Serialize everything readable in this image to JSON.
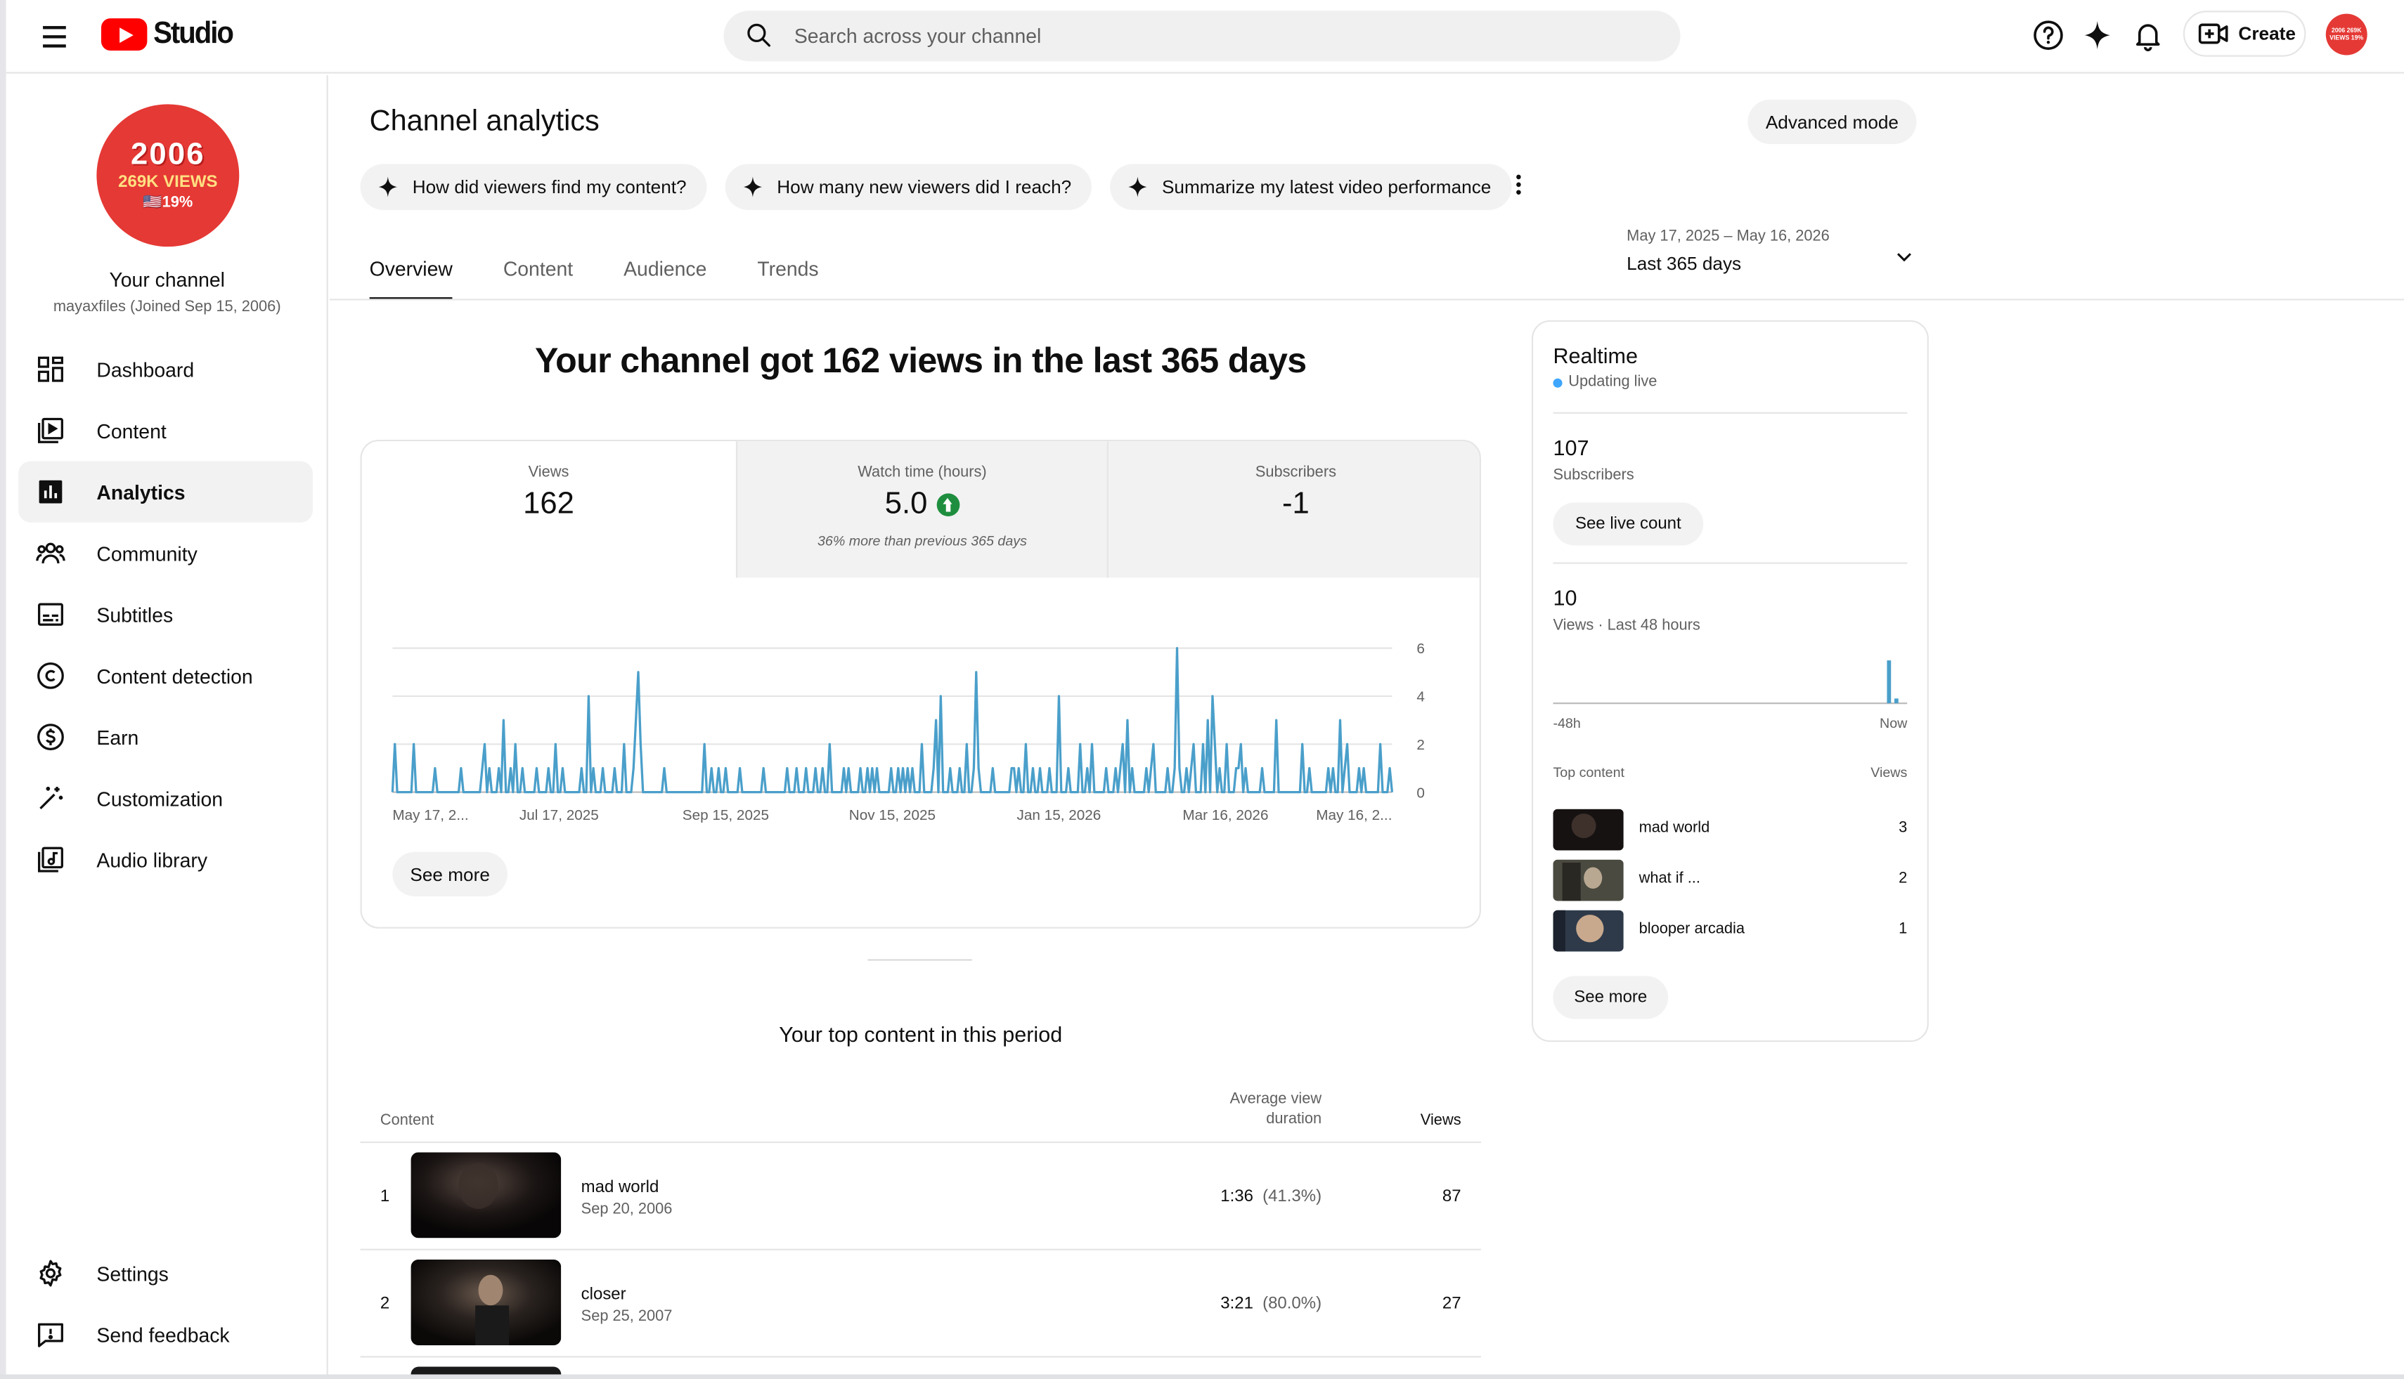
{
  "app": {
    "logo_text": "Studio",
    "brand_color": "#ff0000",
    "accent_color": "#3ea6ff",
    "positive_color": "#1e8e3e"
  },
  "header": {
    "search_placeholder": "Search across your channel",
    "create_label": "Create",
    "avatar_text": "2006 269K VIEWS 19%",
    "icons": [
      "menu-icon",
      "search-icon",
      "help-icon",
      "sparkle-icon",
      "bell-icon",
      "create-video-icon"
    ]
  },
  "sidebar": {
    "avatar": {
      "line1": "2006",
      "line2": "269K VIEWS",
      "line3": "🇺🇸19%"
    },
    "channel_name": "Your channel",
    "channel_handle": "mayaxfiles (Joined Sep 15, 2006)",
    "items": [
      {
        "label": "Dashboard",
        "icon": "dashboard-icon"
      },
      {
        "label": "Content",
        "icon": "content-icon"
      },
      {
        "label": "Analytics",
        "icon": "analytics-icon",
        "active": true
      },
      {
        "label": "Community",
        "icon": "community-icon"
      },
      {
        "label": "Subtitles",
        "icon": "subtitles-icon"
      },
      {
        "label": "Content detection",
        "icon": "copyright-icon"
      },
      {
        "label": "Earn",
        "icon": "earn-icon"
      },
      {
        "label": "Customization",
        "icon": "magic-wand-icon"
      },
      {
        "label": "Audio library",
        "icon": "audio-library-icon"
      }
    ],
    "bottom_items": [
      {
        "label": "Settings",
        "icon": "gear-icon"
      },
      {
        "label": "Send feedback",
        "icon": "feedback-icon"
      }
    ]
  },
  "main": {
    "title": "Channel analytics",
    "advanced_mode_label": "Advanced mode",
    "chips": [
      "How did viewers find my content?",
      "How many new viewers did I reach?",
      "Summarize my latest video performance"
    ],
    "tabs": [
      "Overview",
      "Content",
      "Audience",
      "Trends"
    ],
    "active_tab": "Overview",
    "date_range": {
      "range": "May 17, 2025 – May 16, 2026",
      "label": "Last 365 days"
    }
  },
  "overview": {
    "headline": "Your channel got 162 views in the last 365 days",
    "metrics": [
      {
        "label": "Views",
        "value": "162",
        "sub": ""
      },
      {
        "label": "Watch time (hours)",
        "value": "5.0",
        "sub": "36% more than previous 365 days",
        "trend": "up"
      },
      {
        "label": "Subscribers",
        "value": "-1",
        "sub": ""
      }
    ],
    "see_more_label": "See more"
  },
  "chart_data": {
    "type": "line",
    "title": "",
    "xlabel": "",
    "ylabel": "",
    "series": [
      {
        "name": "Views",
        "values": [
          0,
          2,
          0,
          0,
          0,
          0,
          0,
          0,
          0,
          2,
          0,
          0,
          0,
          0,
          0,
          0,
          0,
          0,
          1,
          0,
          0,
          0,
          0,
          0,
          0,
          0,
          0,
          0,
          0,
          1,
          0,
          0,
          0,
          0,
          0,
          0,
          0,
          0,
          1,
          2,
          0,
          1,
          0,
          0,
          0,
          1,
          0,
          3,
          0,
          0,
          1,
          0,
          2,
          0,
          0,
          1,
          0,
          0,
          0,
          0,
          0,
          1,
          0,
          0,
          0,
          0,
          1,
          0,
          0,
          2,
          0,
          0,
          1,
          0,
          0,
          0,
          0,
          0,
          0,
          0,
          1,
          0,
          0,
          4,
          0,
          1,
          0,
          0,
          0,
          1,
          0,
          0,
          0,
          0,
          1,
          0,
          0,
          0,
          2,
          0,
          0,
          0,
          1,
          3,
          5,
          2,
          0,
          0,
          0,
          0,
          0,
          0,
          0,
          0,
          0,
          1,
          0,
          0,
          0,
          0,
          0,
          0,
          0,
          0,
          0,
          0,
          0,
          0,
          0,
          0,
          0,
          0,
          2,
          0,
          0,
          1,
          0,
          0,
          1,
          0,
          0,
          1,
          0,
          0,
          0,
          0,
          0,
          1,
          0,
          0,
          0,
          0,
          0,
          0,
          0,
          0,
          0,
          1,
          0,
          0,
          0,
          0,
          0,
          0,
          0,
          0,
          0,
          1,
          0,
          0,
          0,
          1,
          0,
          0,
          0,
          1,
          0,
          0,
          0,
          1,
          0,
          0,
          1,
          0,
          0,
          2,
          0,
          0,
          0,
          0,
          0,
          1,
          0,
          1,
          0,
          0,
          0,
          0,
          1,
          0,
          0,
          1,
          0,
          1,
          0,
          1,
          0,
          0,
          0,
          0,
          0,
          1,
          0,
          0,
          1,
          0,
          1,
          0,
          1,
          0,
          1,
          0,
          0,
          0,
          2,
          0,
          0,
          0,
          0,
          1,
          3,
          0,
          4,
          0,
          0,
          0,
          1,
          0,
          0,
          0,
          1,
          0,
          0,
          2,
          0,
          0,
          1,
          5,
          1,
          0,
          0,
          0,
          0,
          0,
          1,
          0,
          0,
          0,
          0,
          0,
          0,
          0,
          1,
          1,
          0,
          1,
          0,
          0,
          2,
          0,
          0,
          1,
          0,
          0,
          1,
          0,
          0,
          0,
          1,
          0,
          0,
          0,
          4,
          0,
          0,
          0,
          1,
          0,
          0,
          0,
          0,
          2,
          0,
          0,
          1,
          0,
          2,
          0,
          0,
          0,
          0,
          0,
          1,
          0,
          0,
          0,
          1,
          0,
          1,
          2,
          0,
          3,
          0,
          1,
          0,
          0,
          0,
          0,
          0,
          1,
          0,
          1,
          2,
          0,
          0,
          0,
          0,
          0,
          1,
          0,
          0,
          1,
          6,
          1,
          0,
          0,
          1,
          0,
          1,
          2,
          0,
          0,
          0,
          2,
          0,
          3,
          0,
          4,
          2,
          0,
          1,
          0,
          0,
          2,
          0,
          0,
          0,
          1,
          1,
          2,
          0,
          1,
          0,
          0,
          0,
          0,
          0,
          0,
          1,
          0,
          0,
          0,
          0,
          0,
          3,
          0,
          0,
          0,
          0,
          0,
          0,
          0,
          0,
          0,
          0,
          2,
          0,
          0,
          1,
          0,
          0,
          0,
          0,
          0,
          0,
          0,
          1,
          0,
          1,
          0,
          0,
          3,
          0,
          1,
          2,
          0,
          0,
          0,
          0,
          1,
          0,
          1,
          0,
          0,
          0,
          0,
          0,
          0,
          2,
          0,
          0,
          0,
          1,
          0
        ]
      }
    ],
    "x_tick_labels": [
      "May 17, 2...",
      "Jul 17, 2025",
      "Sep 15, 2025",
      "Nov 15, 2025",
      "Jan 15, 2026",
      "Mar 16, 2026",
      "May 16, 2..."
    ],
    "y_ticks": [
      "0",
      "2",
      "4",
      "6"
    ],
    "ylim": [
      0,
      6
    ],
    "grid": true,
    "line_color": "#4a9fca"
  },
  "top_content": {
    "title": "Your top content in this period",
    "headers": {
      "content": "Content",
      "avd_line1": "Average view",
      "avd_line2": "duration",
      "views": "Views"
    },
    "rows": [
      {
        "rank": "1",
        "title": "mad world",
        "date": "Sep 20, 2006",
        "avd": "1:36",
        "avd_pct": "(41.3%)",
        "views": "87"
      },
      {
        "rank": "2",
        "title": "closer",
        "date": "Sep 25, 2007",
        "avd": "3:21",
        "avd_pct": "(80.0%)",
        "views": "27"
      }
    ]
  },
  "realtime": {
    "title": "Realtime",
    "status": "Updating live",
    "subscribers_value": "107",
    "subscribers_label": "Subscribers",
    "live_count_label": "See live count",
    "views_value": "10",
    "views_label": "Views · Last 48 hours",
    "chart_left": "-48h",
    "chart_right": "Now",
    "hourly_views": [
      0,
      0,
      0,
      0,
      0,
      0,
      0,
      0,
      0,
      0,
      0,
      0,
      0,
      0,
      0,
      0,
      0,
      0,
      0,
      0,
      0,
      0,
      0,
      0,
      0,
      0,
      0,
      0,
      0,
      0,
      0,
      0,
      0,
      0,
      0,
      0,
      0,
      0,
      0,
      0,
      0,
      0,
      0,
      0,
      0,
      9,
      1,
      0
    ],
    "top_content_label": "Top content",
    "views_header": "Views",
    "items": [
      {
        "title": "mad world",
        "views": "3"
      },
      {
        "title": "what if ...",
        "views": "2"
      },
      {
        "title": "blooper arcadia",
        "views": "1"
      }
    ],
    "see_more_label": "See more"
  }
}
